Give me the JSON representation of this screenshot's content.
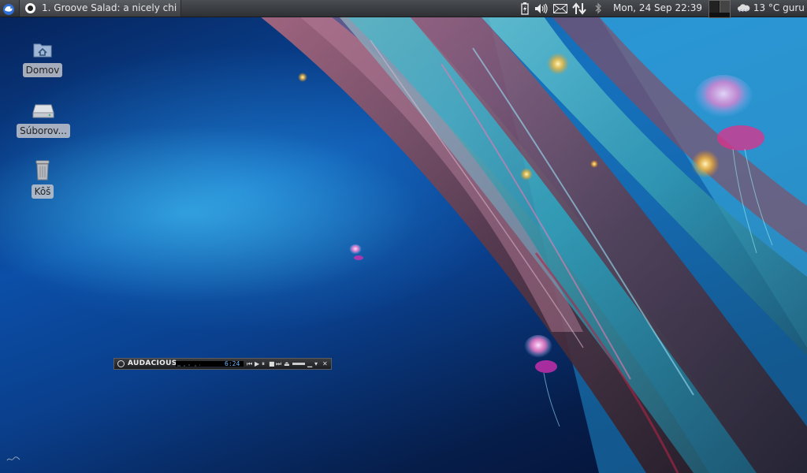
{
  "panel": {
    "menu_icon": "xfce-mouse-icon",
    "task": {
      "icon": "audacious-app-icon",
      "label": "1. Groove Salad: a nicely chi..."
    },
    "tray_icons": [
      "battery-icon",
      "volume-icon",
      "mail-icon",
      "network-updown-icon",
      "bluetooth-icon"
    ],
    "clock": "Mon, 24 Sep  22:39",
    "weather": {
      "icon": "weather-cloud-icon",
      "text": "13 °C guru"
    }
  },
  "desktop": {
    "icons": [
      {
        "label": "Domov",
        "icon": "home-folder-icon"
      },
      {
        "label": "Súborov...",
        "icon": "drive-icon"
      },
      {
        "label": "Kôš",
        "icon": "trash-icon"
      }
    ]
  },
  "audacious": {
    "title": "AUDACIOUS",
    "time": "6:24",
    "controls": {
      "prev": "⏮",
      "play": "▶",
      "pause": "⏸",
      "stop": "■",
      "next": "⏭",
      "eject": "⏏",
      "minimize": "▁",
      "shade": "▾",
      "close": "✕"
    }
  }
}
